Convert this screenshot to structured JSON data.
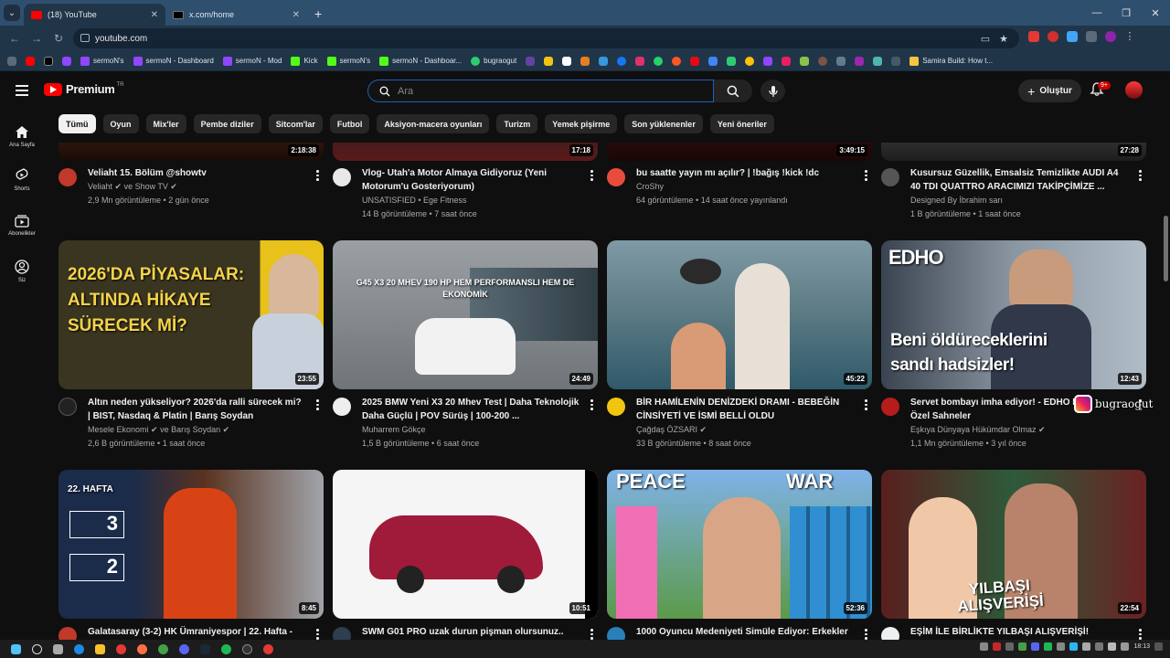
{
  "browser": {
    "tabs": [
      {
        "title": "(18) YouTube",
        "favicon_color": "#ff0000",
        "active": true
      },
      {
        "title": "x.com/home",
        "favicon_color": "#000000",
        "active": false
      }
    ],
    "new_tab_symbol": "+",
    "window_controls": [
      "—",
      "❐",
      "✕"
    ],
    "address": "youtube.com",
    "bookmarks": [
      {
        "label": "sermoN's",
        "color": "#9146ff"
      },
      {
        "label": "sermoN - Dashboard",
        "color": "#9146ff"
      },
      {
        "label": "sermoN - Mod",
        "color": "#9146ff"
      },
      {
        "label": "Kick",
        "color": "#53fc18"
      },
      {
        "label": "sermoN's",
        "color": "#53fc18"
      },
      {
        "label": "sermoN - Dashboar...",
        "color": "#53fc18"
      },
      {
        "label": "bugraogut",
        "color": "#2ecc71"
      },
      {
        "label": "Samira Build: How t...",
        "color": "#f5c542"
      }
    ]
  },
  "yt": {
    "logo_text": "Premium",
    "logo_tr": "TR",
    "search_placeholder": "Ara",
    "create_label": "Oluştur",
    "notif_count": "9+",
    "sidenav": [
      {
        "label": "Ana Sayfa",
        "icon": "home-icon"
      },
      {
        "label": "Shorts",
        "icon": "shorts-icon"
      },
      {
        "label": "Abonelikler",
        "icon": "subscriptions-icon"
      },
      {
        "label": "Siz",
        "icon": "you-icon"
      }
    ],
    "chips": [
      "Tümü",
      "Oyun",
      "Mix'ler",
      "Pembe diziler",
      "Sitcom'lar",
      "Futbol",
      "Aksiyon-macera oyunları",
      "Turizm",
      "Yemek pişirme",
      "Son yüklenenler",
      "Yeni öneriler"
    ]
  },
  "videos": [
    {
      "duration": "2:18:38",
      "title": "Veliaht 15. Bölüm @showtv",
      "channel": "Veliaht ✔ ve Show TV ✔",
      "meta": "2,9 Mn görüntüleme • 2 gün önce",
      "thumb_color": "#5a2b1e",
      "avatar_color": "#c0392b"
    },
    {
      "duration": "17:18",
      "title": "Vlog- Utah'a Motor Almaya Gidiyoruz (Yeni Motorum'u Gosteriyorum)",
      "channel": "UNSATISFIED • Ege Fitness",
      "meta": "14 B görüntüleme • 7 saat önce",
      "thumb_color": "#3b1f1f",
      "avatar_color": "#dddddd"
    },
    {
      "duration": "3:49:15",
      "title": "bu saatte yayın mı açılır? | !bağış !kick !dc",
      "channel": "CroShy",
      "meta": "64 görüntüleme • 14 saat önce yayınlandı",
      "thumb_color": "#2a1212",
      "avatar_color": "#e74c3c"
    },
    {
      "duration": "27:28",
      "title": "Kusursuz Güzellik, Emsalsiz Temizlikte AUDI A4 40 TDI QUATTRO ARACIMIZI TAKİPÇİMİZE ...",
      "channel": "Designed By İbrahim sarı",
      "meta": "1 B görüntüleme • 1 saat önce",
      "thumb_color": "#2b2b2b",
      "avatar_color": "#555555"
    },
    {
      "duration": "23:55",
      "title": "Altın neden yükseliyor? 2026'da ralli sürecek mi? | BIST, Nasdaq & Platin | Barış Soydan",
      "channel": "Mesele Ekonomi ✔ ve Barış Soydan ✔",
      "meta": "2,6 B görüntüleme • 1 saat önce",
      "thumb_color": "#2d2a1c",
      "avatar_color": "#222222",
      "overlay": "2026'DA PİYASALAR: ALTINDA HİKAYE SÜRECEK Mİ?"
    },
    {
      "duration": "24:49",
      "title": "2025 BMW Yeni X3 20 Mhev Test | Daha Teknolojik Daha Güçlü | POV Sürüş | 100-200 ...",
      "channel": "Muharrem Gökçe",
      "meta": "1,5 B görüntüleme • 6 saat önce",
      "thumb_color": "#8b9092",
      "avatar_color": "#eeeeee",
      "overlay": "G45 X3 20 MHEV 190 HP HEM PERFORMANSLI HEM DE EKONOMİK"
    },
    {
      "duration": "45:22",
      "title": "BİR HAMİLENİN DENİZDEKİ DRAMI - BEBEĞİN CİNSİYETİ VE İSMİ BELLİ OLDU",
      "channel": "Çağdaş ÖZSARI ✔",
      "meta": "33 B görüntüleme • 8 saat önce",
      "thumb_color": "#4a6b78",
      "avatar_color": "#f1c40f"
    },
    {
      "duration": "12:43",
      "title": "Servet bombayı imha ediyor! - EDHO En Özel Sahneler",
      "channel": "Eşkıya Dünyaya Hükümdar Olmaz ✔",
      "meta": "1,1 Mn görüntüleme • 3 yıl önce",
      "thumb_color": "#6b7a8a",
      "avatar_color": "#b71c1c",
      "overlay": "Beni öldüreceklerini sandı hadsizler!",
      "badge": "EDHO"
    },
    {
      "duration": "8:45",
      "title": "Galatasaray (3-2) HK Ümraniyespor | 22. Hafta -",
      "channel": "",
      "meta": "",
      "thumb_color": "#1b2b4a",
      "avatar_color": "#c0392b",
      "overlay": "22. HAFTA"
    },
    {
      "duration": "10:51",
      "title": "SWM G01 PRO uzak durun pişman olursunuz..",
      "channel": "",
      "meta": "",
      "thumb_color": "#f4f4f4",
      "avatar_color": "#2c3e50"
    },
    {
      "duration": "52:36",
      "title": "1000 Oyuncu Medeniyeti Simüle Ediyor: Erkekler",
      "channel": "",
      "meta": "",
      "thumb_color": "#6a9bd4",
      "avatar_color": "#2980b9",
      "overlay": "PEACE",
      "overlay2": "WAR"
    },
    {
      "duration": "22:54",
      "title": "EŞİM İLE BİRLİKTE YILBAŞI ALIŞVERİŞİ!",
      "channel": "",
      "meta": "",
      "thumb_color": "#7a2a2a",
      "avatar_color": "#ecf0f1",
      "overlay": "YILBAŞI ALIŞVERİŞİ"
    }
  ],
  "watermark": "bugraogut",
  "taskbar": {
    "clock": "18:13"
  }
}
